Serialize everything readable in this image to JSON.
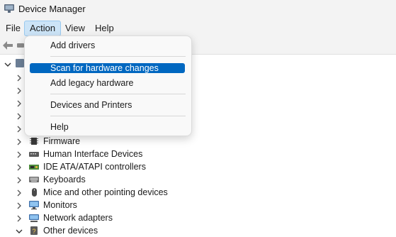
{
  "window": {
    "title": "Device Manager"
  },
  "menubar": {
    "items": [
      "File",
      "Action",
      "View",
      "Help"
    ]
  },
  "action_menu": {
    "items": [
      "Add drivers",
      "Scan for hardware changes",
      "Add legacy hardware",
      "Devices and Printers",
      "Help"
    ],
    "highlighted": "Scan for hardware changes"
  },
  "tree": {
    "devices": [
      {
        "label": "Firmware",
        "icon": "firmware-icon"
      },
      {
        "label": "Human Interface Devices",
        "icon": "hid-icon"
      },
      {
        "label": "IDE ATA/ATAPI controllers",
        "icon": "ide-controller-icon"
      },
      {
        "label": "Keyboards",
        "icon": "keyboard-icon"
      },
      {
        "label": "Mice and other pointing devices",
        "icon": "mouse-icon"
      },
      {
        "label": "Monitors",
        "icon": "monitor-icon"
      },
      {
        "label": "Network adapters",
        "icon": "network-adapter-icon"
      },
      {
        "label": "Other devices",
        "icon": "other-devices-icon"
      }
    ]
  },
  "colors": {
    "highlight": "#0067c0",
    "active_menu_bg": "#cce4f7"
  }
}
